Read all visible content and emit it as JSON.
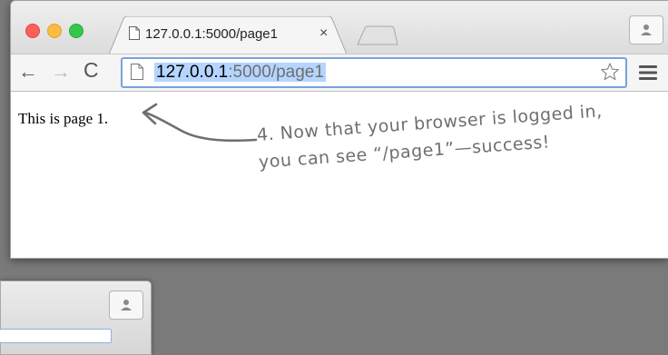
{
  "tab": {
    "title": "127.0.0.1:5000/page1",
    "close_glyph": "×"
  },
  "toolbar": {
    "back_glyph": "←",
    "forward_glyph": "→",
    "reload_glyph": "C",
    "url_host": "127.0.0.1",
    "url_path": ":5000/page1"
  },
  "page": {
    "text": "This is page 1."
  },
  "annotation": {
    "line1": "4. Now that your browser is logged in,",
    "line2": "you can see “/page1”—success!"
  },
  "icons": {
    "window_close": "close-icon",
    "window_minimize": "minimize-icon",
    "window_maximize": "maximize-icon",
    "tab_document": "document-icon",
    "new_tab": "new-tab-icon",
    "profile": "profile-icon",
    "bookmark": "star-icon",
    "menu": "hamburger-menu-icon"
  },
  "colors": {
    "close": "#fc605b",
    "minimize": "#fdbc40",
    "maximize": "#34c84a",
    "url_selection": "#b5d5ff",
    "omnibox_focus": "#78a3dc",
    "annotation": "#6f6f6f"
  }
}
